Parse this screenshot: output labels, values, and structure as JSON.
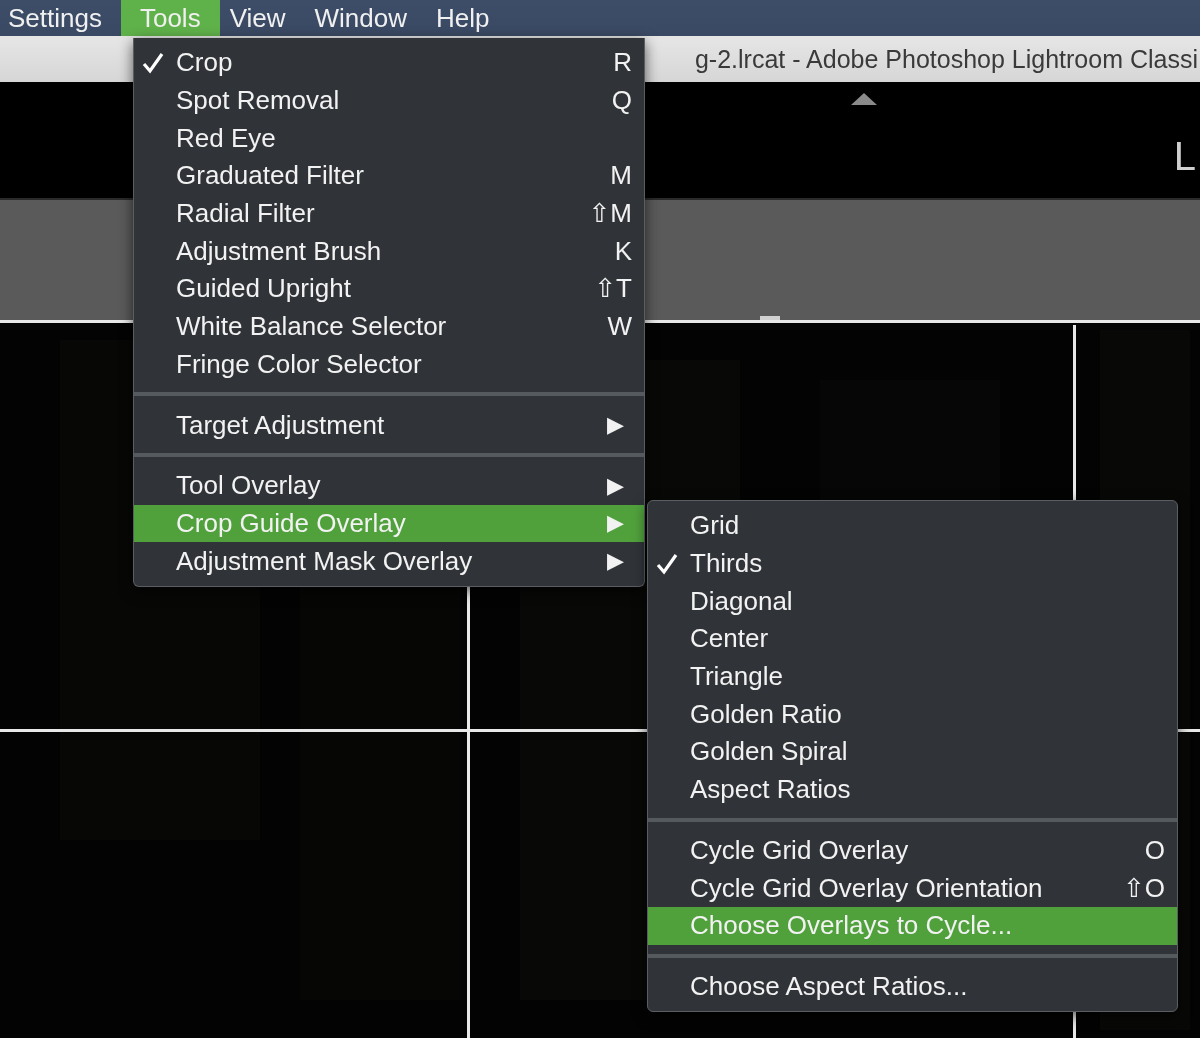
{
  "menu_bar": [
    {
      "label": "Settings",
      "selected": false
    },
    {
      "label": "Tools",
      "selected": true
    },
    {
      "label": "View",
      "selected": false
    },
    {
      "label": "Window",
      "selected": false
    },
    {
      "label": "Help",
      "selected": false
    }
  ],
  "title_bar": {
    "title": "g-2.lrcat - Adobe Photoshop Lightroom Classi"
  },
  "toolbar": {
    "text": "L"
  },
  "tools_menu": {
    "groups": [
      [
        {
          "label": "Crop",
          "shortcut": "R",
          "checked": true,
          "selected": false
        },
        {
          "label": "Spot Removal",
          "shortcut": "Q",
          "checked": false,
          "selected": false
        },
        {
          "label": "Red Eye",
          "checked": false,
          "selected": false
        },
        {
          "label": "Graduated Filter",
          "shortcut": "M",
          "checked": false,
          "selected": false
        },
        {
          "label": "Radial Filter",
          "shortcut": "⇧M",
          "checked": false,
          "selected": false
        },
        {
          "label": "Adjustment Brush",
          "shortcut": "K",
          "checked": false,
          "selected": false
        },
        {
          "label": "Guided Upright",
          "shortcut": "⇧T",
          "checked": false,
          "selected": false
        },
        {
          "label": "White Balance Selector",
          "shortcut": "W",
          "checked": false,
          "selected": false
        },
        {
          "label": "Fringe Color Selector",
          "checked": false,
          "selected": false
        }
      ],
      [
        {
          "label": "Target Adjustment",
          "submenu_arrow": "▶",
          "checked": false,
          "selected": false
        }
      ],
      [
        {
          "label": "Tool Overlay",
          "submenu_arrow": "▶",
          "checked": false,
          "selected": false
        },
        {
          "label": "Crop Guide Overlay",
          "submenu_arrow": "▶",
          "checked": false,
          "selected": true
        },
        {
          "label": "Adjustment Mask Overlay",
          "submenu_arrow": "▶",
          "checked": false,
          "selected": false
        }
      ]
    ]
  },
  "crop_guide_submenu": {
    "groups": [
      [
        {
          "label": "Grid",
          "checked": false,
          "selected": false
        },
        {
          "label": "Thirds",
          "checked": true,
          "selected": false
        },
        {
          "label": "Diagonal",
          "checked": false,
          "selected": false
        },
        {
          "label": "Center",
          "checked": false,
          "selected": false
        },
        {
          "label": "Triangle",
          "checked": false,
          "selected": false
        },
        {
          "label": "Golden Ratio",
          "checked": false,
          "selected": false
        },
        {
          "label": "Golden Spiral",
          "checked": false,
          "selected": false
        },
        {
          "label": "Aspect Ratios",
          "checked": false,
          "selected": false
        }
      ],
      [
        {
          "label": "Cycle Grid Overlay",
          "shortcut": "O",
          "checked": false,
          "selected": false
        },
        {
          "label": "Cycle Grid Overlay Orientation",
          "shortcut": "⇧O",
          "checked": false,
          "selected": false
        },
        {
          "label": "Choose Overlays to Cycle...",
          "checked": false,
          "selected": true
        }
      ],
      [
        {
          "label": "Choose Aspect Ratios...",
          "checked": false,
          "selected": false
        }
      ]
    ]
  }
}
